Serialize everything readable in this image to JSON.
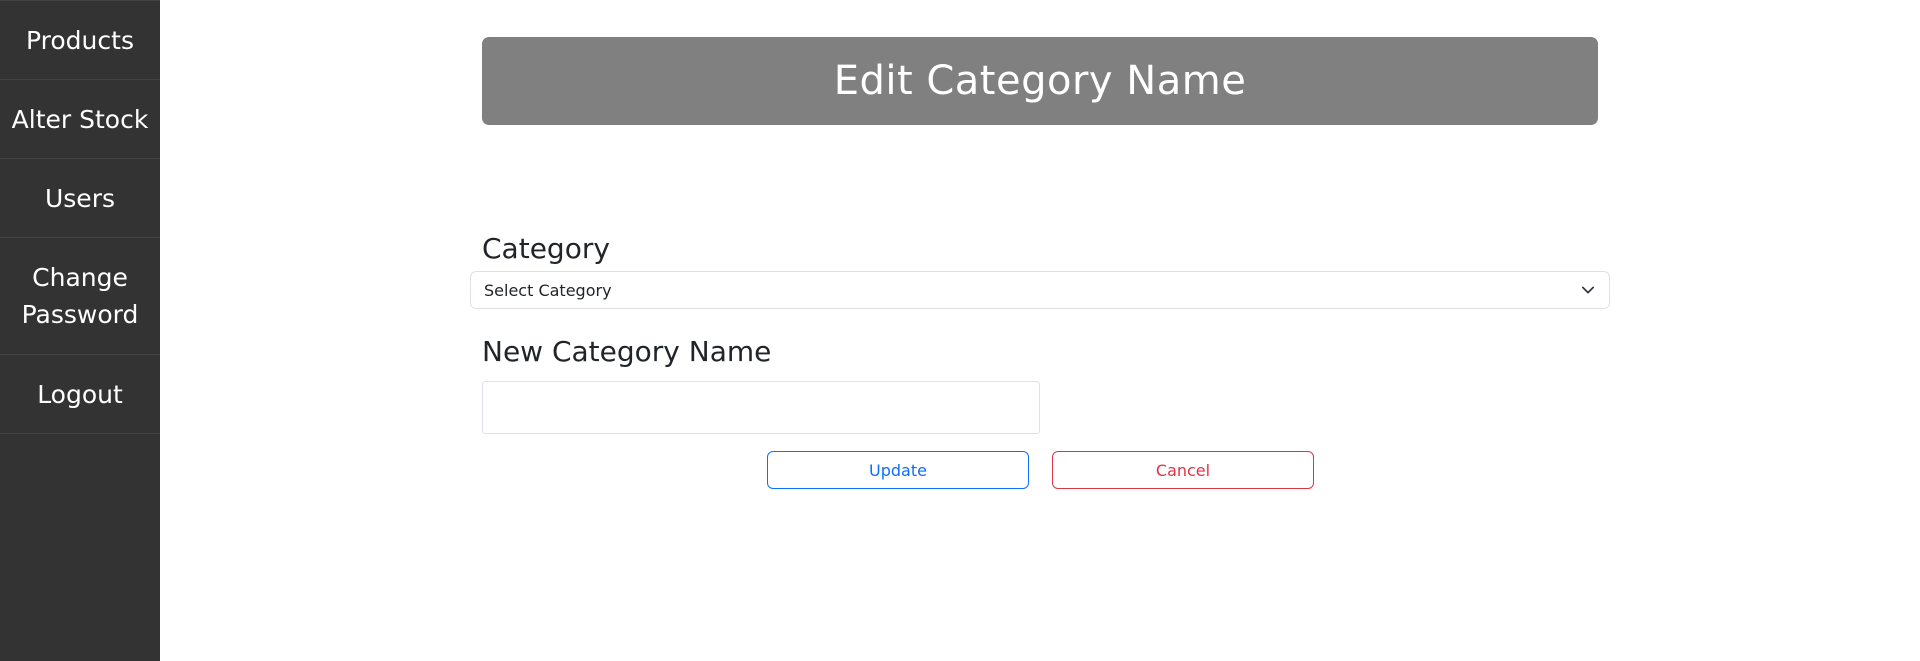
{
  "sidebar": {
    "items": [
      {
        "lines": [
          "Products"
        ]
      },
      {
        "lines": [
          "Alter Stock"
        ]
      },
      {
        "lines": [
          "Users"
        ]
      },
      {
        "lines": [
          "Change",
          "Password"
        ]
      },
      {
        "lines": [
          "Logout"
        ]
      }
    ]
  },
  "header": {
    "title": "Edit Category Name"
  },
  "form": {
    "category_label": "Category",
    "category_select": {
      "selected": "Select Category"
    },
    "new_name_label": "New Category Name",
    "new_name_value": "",
    "update_label": "Update",
    "cancel_label": "Cancel"
  },
  "icons": {
    "select_chevron": "chevron-down-icon"
  },
  "colors": {
    "sidebar_bg": "#333333",
    "header_bg": "#808080",
    "primary": "#0d6efd",
    "danger": "#dc3545"
  }
}
